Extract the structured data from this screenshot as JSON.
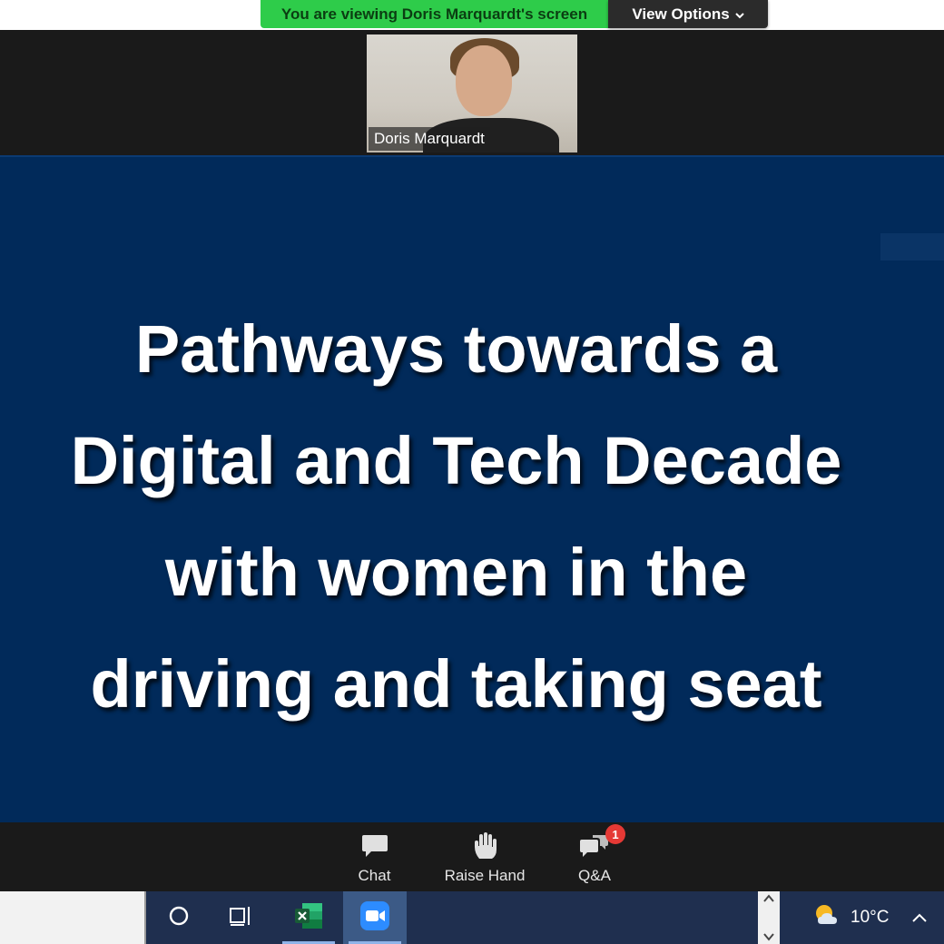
{
  "banner": {
    "viewing_text": "You are viewing Doris Marquardt's screen",
    "view_options_label": "View Options",
    "banner_color": "#2ecc4a"
  },
  "participant": {
    "name": "Doris Marquardt"
  },
  "slide": {
    "background_color": "#012a5a",
    "title_lines": [
      "Pathways towards a",
      "Digital and Tech Decade",
      "with women in the",
      "driving and taking seat"
    ]
  },
  "toolbar": {
    "chat_label": "Chat",
    "raise_hand_label": "Raise Hand",
    "qa_label": "Q&A",
    "qa_badge": "1",
    "icons": [
      "chat-icon",
      "raise-hand-icon",
      "qa-icon"
    ]
  },
  "taskbar": {
    "apps": [
      "cortana-icon",
      "task-view-icon",
      "excel-icon",
      "zoom-icon"
    ],
    "active_app": "zoom-icon",
    "temperature": "10°C",
    "weather_icon": "partly-sunny-icon"
  }
}
